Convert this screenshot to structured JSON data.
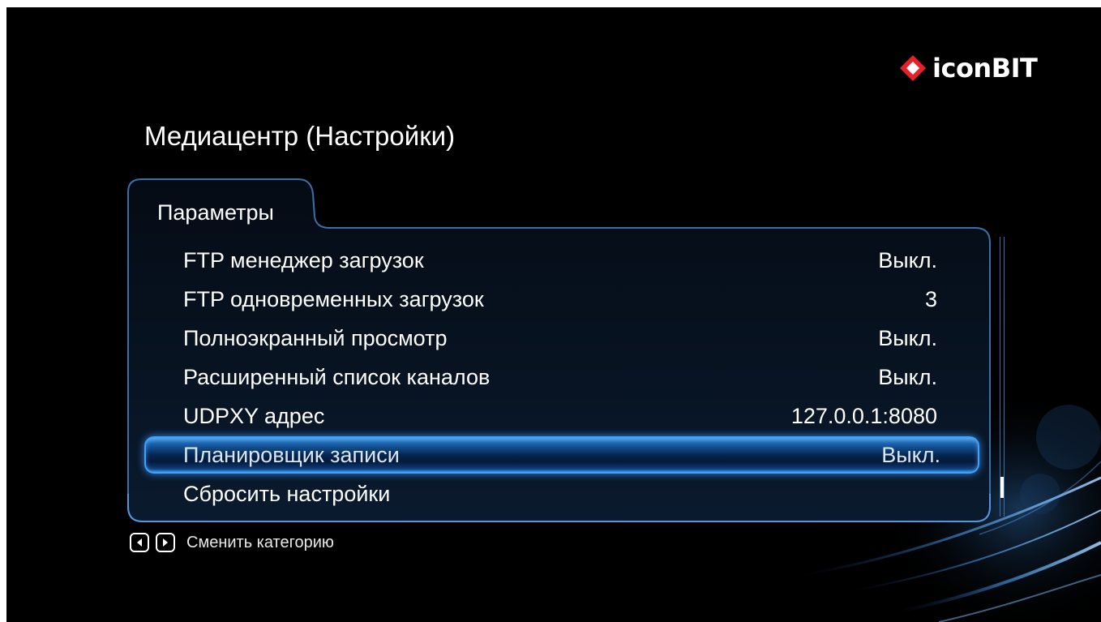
{
  "header": {
    "brand": "iconBIT",
    "title": "Медиацентр (Настройки)"
  },
  "tab": {
    "label": "Параметры"
  },
  "settings": [
    {
      "label": "FTP менеджер загрузок",
      "value": "Выкл."
    },
    {
      "label": "FTP одновременных загрузок",
      "value": "3"
    },
    {
      "label": "Полноэкранный просмотр",
      "value": "Выкл."
    },
    {
      "label": "Расширенный список каналов",
      "value": "Выкл."
    },
    {
      "label": "UDPXY адрес",
      "value": "127.0.0.1:8080"
    },
    {
      "label": "Планировщик записи",
      "value": "Выкл.",
      "selected": true
    },
    {
      "label": "Сбросить настройки",
      "value": ""
    }
  ],
  "footer": {
    "hint": "Сменить категорию",
    "left_icon": "arrow-left-icon",
    "right_icon": "arrow-right-icon"
  },
  "colors": {
    "background": "#000000",
    "panel_border": "#3c6fa8",
    "selection_glow": "#3fa0ff",
    "logo_accent": "#e8202a"
  }
}
